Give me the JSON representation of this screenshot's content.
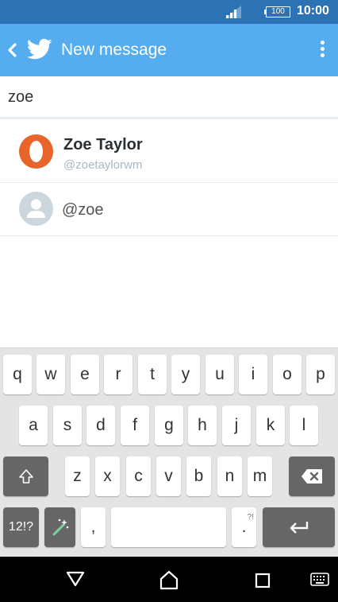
{
  "status_bar": {
    "battery": "100",
    "time": "10:00"
  },
  "app_bar": {
    "title": "New message"
  },
  "search": {
    "value": "zoe",
    "placeholder": ""
  },
  "results": [
    {
      "name": "Zoe Taylor",
      "handle": "@zoetaylorwm"
    },
    {
      "handle": "@zoe"
    }
  ],
  "keyboard": {
    "row1": [
      "q",
      "w",
      "e",
      "r",
      "t",
      "y",
      "u",
      "i",
      "o",
      "p"
    ],
    "row2": [
      "a",
      "s",
      "d",
      "f",
      "g",
      "h",
      "j",
      "k",
      "l"
    ],
    "row3": [
      "z",
      "x",
      "c",
      "v",
      "b",
      "n",
      "m"
    ],
    "symbols_label": "12!?",
    "comma": ",",
    "period": ".",
    "period_alt": "?!"
  },
  "colors": {
    "status_bar": "#2d72b3",
    "app_bar": "#55acee",
    "avatar_orange": "#e8642a"
  },
  "icons": [
    "signal-icon",
    "battery-icon",
    "back-icon",
    "twitter-bird-icon",
    "overflow-menu-icon",
    "shift-icon",
    "backspace-icon",
    "magic-wand-icon",
    "enter-icon",
    "back-triangle-icon",
    "home-icon",
    "recents-icon",
    "keyboard-icon"
  ]
}
